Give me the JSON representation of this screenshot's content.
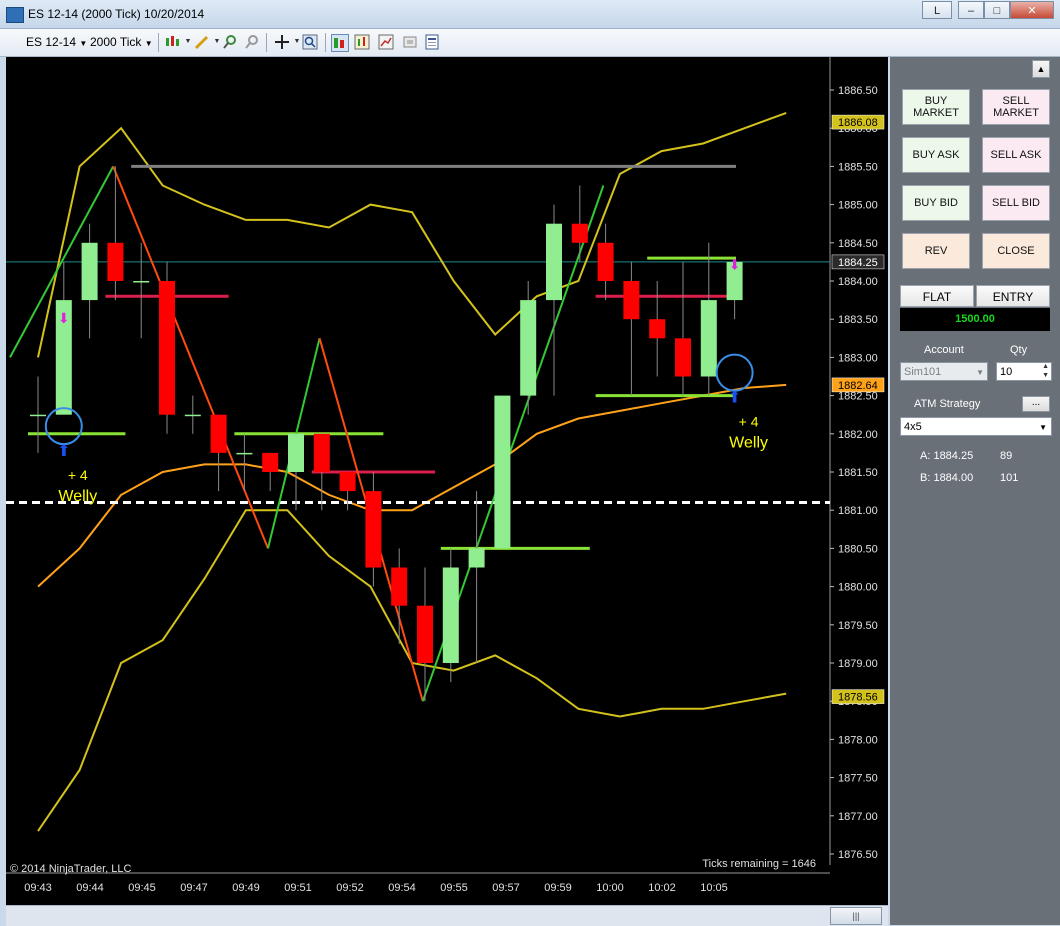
{
  "window": {
    "title": "ES 12-14 (2000 Tick)  10/20/2014",
    "btn_link": "L",
    "btn_min": "–",
    "btn_max": "□",
    "btn_close": "✕"
  },
  "toolbar": {
    "instrument": "ES 12-14",
    "period": "2000 Tick"
  },
  "icons": {
    "bar_type": "candlestick-icon",
    "draw": "pencil-icon",
    "zoom_in": "zoom-in-icon",
    "zoom_out": "zoom-out-icon",
    "crosshair": "crosshair-icon",
    "magnifier": "magnifier-icon",
    "chart_trader": "chart-trader-icon",
    "indicators": "indicators-icon",
    "strategies": "strategies-icon",
    "snapshot": "snapshot-icon",
    "properties": "properties-icon"
  },
  "colors": {
    "background": "#000000",
    "up_candle": "#90ee90",
    "down_candle": "#ff0000",
    "bollinger": "#d4c21c",
    "ema": "#ffa21a",
    "zigzag_up": "#34c934",
    "zigzag_down": "#ff4a10",
    "support": "#8ae234",
    "resistance": "#dc1f4a",
    "current_price": "#1c8c8c",
    "marker_up": "#1d4ff0",
    "marker_down": "#e01fe0",
    "signal_text": "#ffff00"
  },
  "chart_data": {
    "type": "candlestick",
    "y_ticks": [
      1886.5,
      1886.0,
      1885.5,
      1885.0,
      1884.5,
      1884.0,
      1883.5,
      1883.0,
      1882.5,
      1882.0,
      1881.5,
      1881.0,
      1880.5,
      1880.0,
      1879.5,
      1879.0,
      1878.5,
      1878.0,
      1877.5,
      1877.0,
      1876.5
    ],
    "y_tick_labels": [
      "1886.50",
      "1886.00",
      "1885.50",
      "1885.00",
      "1884.50",
      "1884.00",
      "1883.50",
      "1883.00",
      "1882.50",
      "1882.00",
      "1881.50",
      "1881.00",
      "1880.50",
      "1880.00",
      "1879.50",
      "1879.00",
      "1878.50",
      "1878.00",
      "1877.50",
      "1877.00",
      "1876.50"
    ],
    "ylim": [
      1876.25,
      1887.0
    ],
    "x_labels": [
      "09:43",
      "09:44",
      "09:45",
      "09:47",
      "09:49",
      "09:51",
      "09:52",
      "09:54",
      "09:55",
      "09:57",
      "09:59",
      "10:00",
      "10:02",
      "10:05"
    ],
    "candles": [
      {
        "o": 1882.25,
        "h": 1882.75,
        "l": 1881.75,
        "c": 1882.25
      },
      {
        "o": 1882.25,
        "h": 1884.25,
        "l": 1882.25,
        "c": 1883.75
      },
      {
        "o": 1883.75,
        "h": 1884.75,
        "l": 1883.25,
        "c": 1884.5
      },
      {
        "o": 1884.5,
        "h": 1885.5,
        "l": 1883.75,
        "c": 1884.0
      },
      {
        "o": 1884.0,
        "h": 1884.5,
        "l": 1883.25,
        "c": 1884.0
      },
      {
        "o": 1884.0,
        "h": 1884.25,
        "l": 1882.0,
        "c": 1882.25
      },
      {
        "o": 1882.25,
        "h": 1882.5,
        "l": 1882.0,
        "c": 1882.25
      },
      {
        "o": 1882.25,
        "h": 1882.25,
        "l": 1881.25,
        "c": 1881.75
      },
      {
        "o": 1881.75,
        "h": 1882.0,
        "l": 1881.25,
        "c": 1881.75
      },
      {
        "o": 1881.75,
        "h": 1881.75,
        "l": 1881.25,
        "c": 1881.5
      },
      {
        "o": 1881.5,
        "h": 1882.0,
        "l": 1881.0,
        "c": 1882.0
      },
      {
        "o": 1882.0,
        "h": 1882.0,
        "l": 1881.0,
        "c": 1881.5
      },
      {
        "o": 1881.5,
        "h": 1881.5,
        "l": 1881.0,
        "c": 1881.25
      },
      {
        "o": 1881.25,
        "h": 1881.5,
        "l": 1880.0,
        "c": 1880.25
      },
      {
        "o": 1880.25,
        "h": 1880.5,
        "l": 1879.25,
        "c": 1879.75
      },
      {
        "o": 1879.75,
        "h": 1880.25,
        "l": 1878.5,
        "c": 1879.0
      },
      {
        "o": 1879.0,
        "h": 1880.5,
        "l": 1878.75,
        "c": 1880.25
      },
      {
        "o": 1880.25,
        "h": 1881.25,
        "l": 1879.0,
        "c": 1880.5
      },
      {
        "o": 1880.5,
        "h": 1882.5,
        "l": 1880.5,
        "c": 1882.5
      },
      {
        "o": 1882.5,
        "h": 1884.0,
        "l": 1882.25,
        "c": 1883.75
      },
      {
        "o": 1883.75,
        "h": 1885.0,
        "l": 1882.5,
        "c": 1884.75
      },
      {
        "o": 1884.75,
        "h": 1885.25,
        "l": 1884.25,
        "c": 1884.5
      },
      {
        "o": 1884.5,
        "h": 1884.75,
        "l": 1883.75,
        "c": 1884.0
      },
      {
        "o": 1884.0,
        "h": 1884.25,
        "l": 1882.5,
        "c": 1883.5
      },
      {
        "o": 1883.5,
        "h": 1884.0,
        "l": 1882.75,
        "c": 1883.25
      },
      {
        "o": 1883.25,
        "h": 1884.25,
        "l": 1882.5,
        "c": 1882.75
      },
      {
        "o": 1882.75,
        "h": 1884.5,
        "l": 1882.5,
        "c": 1883.75
      },
      {
        "o": 1883.75,
        "h": 1884.25,
        "l": 1883.5,
        "c": 1884.25
      }
    ],
    "bollinger_upper": [
      1883.0,
      1885.5,
      1886.0,
      1885.25,
      1885.0,
      1884.8,
      1884.8,
      1884.7,
      1885.0,
      1884.9,
      1884.0,
      1883.3,
      1883.8,
      1884.0,
      1885.4,
      1885.7,
      1885.8,
      1886.0,
      1886.2
    ],
    "bollinger_lower": [
      1876.8,
      1877.6,
      1879.0,
      1879.3,
      1880.1,
      1881.0,
      1881.0,
      1880.4,
      1880.0,
      1879.0,
      1878.9,
      1879.1,
      1878.8,
      1878.4,
      1878.3,
      1878.4,
      1878.4,
      1878.5,
      1878.6
    ],
    "ema": [
      1880.0,
      1880.5,
      1881.2,
      1881.5,
      1881.6,
      1881.6,
      1881.5,
      1881.2,
      1881.0,
      1881.0,
      1881.3,
      1881.6,
      1882.0,
      1882.2,
      1882.3,
      1882.4,
      1882.5,
      1882.6,
      1882.64
    ],
    "zigzag": [
      {
        "i": 0,
        "p": 1883.0
      },
      {
        "i": 4,
        "p": 1885.5
      },
      {
        "i": 10,
        "p": 1880.5
      },
      {
        "i": 12,
        "p": 1883.25
      },
      {
        "i": 16,
        "p": 1878.5
      },
      {
        "i": 23,
        "p": 1885.25
      }
    ],
    "current_price": 1884.25,
    "price_markers": [
      {
        "label": "1886.08",
        "value": 1886.08,
        "bg": "#d4c21c"
      },
      {
        "label": "1884.25",
        "value": 1884.25,
        "bg": "#2a2a2a"
      },
      {
        "label": "1882.64",
        "value": 1882.64,
        "bg": "#ffa21a"
      },
      {
        "label": "1878.56",
        "value": 1878.56,
        "bg": "#d4c21c"
      }
    ],
    "level_lines": [
      {
        "value": 1885.5,
        "from": 4,
        "to": 27,
        "color": "#808080"
      },
      {
        "value": 1881.1,
        "from": 0,
        "to": 33,
        "color": "#ffffff",
        "dashed": true
      },
      {
        "value": 1882.0,
        "from": 0,
        "to": 3,
        "color": "#8ae234"
      },
      {
        "value": 1883.8,
        "from": 3,
        "to": 7,
        "color": "#dc1f4a"
      },
      {
        "value": 1882.0,
        "from": 8,
        "to": 13,
        "color": "#8ae234"
      },
      {
        "value": 1881.5,
        "from": 11,
        "to": 15,
        "color": "#dc1f4a"
      },
      {
        "value": 1880.5,
        "from": 16,
        "to": 21,
        "color": "#8ae234"
      },
      {
        "value": 1884.3,
        "from": 24,
        "to": 29,
        "color": "#8ae234"
      },
      {
        "value": 1883.8,
        "from": 22,
        "to": 28,
        "color": "#dc1f4a"
      },
      {
        "value": 1882.5,
        "from": 22,
        "to": 28,
        "color": "#8ae234"
      }
    ],
    "signals": [
      {
        "index": 1,
        "value": 1882.1,
        "line1": "+ 4",
        "line2": "Welly"
      },
      {
        "index": 27,
        "value": 1882.8,
        "line1": "+ 4",
        "line2": "Welly"
      }
    ],
    "copyright": "© 2014 NinjaTrader, LLC",
    "ticks_remaining": "Ticks remaining = 1646"
  },
  "panel": {
    "buttons": [
      {
        "id": "buy-market",
        "label": "BUY\nMARKET",
        "kind": "buy"
      },
      {
        "id": "sell-market",
        "label": "SELL\nMARKET",
        "kind": "sell"
      },
      {
        "id": "buy-ask",
        "label": "BUY ASK",
        "kind": "buy"
      },
      {
        "id": "sell-ask",
        "label": "SELL ASK",
        "kind": "sell"
      },
      {
        "id": "buy-bid",
        "label": "BUY BID",
        "kind": "buy"
      },
      {
        "id": "sell-bid",
        "label": "SELL BID",
        "kind": "sell"
      },
      {
        "id": "rev",
        "label": "REV",
        "kind": "neutral"
      },
      {
        "id": "close",
        "label": "CLOSE",
        "kind": "neutral"
      }
    ],
    "flat_label": "FLAT",
    "entry_label": "ENTRY",
    "position_value": "1500.00",
    "account_label": "Account",
    "qty_label": "Qty",
    "account_value": "Sim101",
    "qty_value": "10",
    "atm_label": "ATM Strategy",
    "atm_more": "...",
    "atm_value": "4x5",
    "quote_a_label": "A: 1884.25",
    "quote_a_size": "89",
    "quote_b_label": "B: 1884.00",
    "quote_b_size": "101"
  },
  "scroll": {
    "thumb": "|||"
  }
}
